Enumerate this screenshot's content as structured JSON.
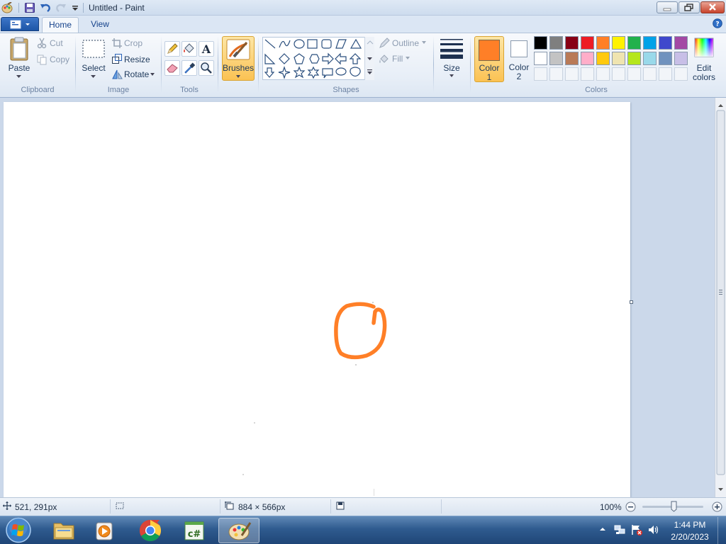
{
  "window": {
    "title": "Untitled - Paint"
  },
  "tabs": {
    "home": "Home",
    "view": "View"
  },
  "clipboard": {
    "group": "Clipboard",
    "paste": "Paste",
    "cut": "Cut",
    "copy": "Copy"
  },
  "image": {
    "group": "Image",
    "select": "Select",
    "crop": "Crop",
    "resize": "Resize",
    "rotate": "Rotate"
  },
  "tools": {
    "group": "Tools"
  },
  "brushes": {
    "label": "Brushes"
  },
  "shapes": {
    "group": "Shapes",
    "outline": "Outline",
    "fill": "Fill"
  },
  "size": {
    "label": "Size"
  },
  "colors": {
    "group": "Colors",
    "color1_line1": "Color",
    "color1_line2": "1",
    "color2_line1": "Color",
    "color2_line2": "2",
    "edit_line1": "Edit",
    "edit_line2": "colors",
    "color1_value": "#ff7f27",
    "color2_value": "#ffffff",
    "palette_row1": [
      "#000000",
      "#7f7f7f",
      "#880015",
      "#ed1c24",
      "#ff7f27",
      "#fff200",
      "#22b14c",
      "#00a2e8",
      "#3f48cc",
      "#a349a4"
    ],
    "palette_row2": [
      "#ffffff",
      "#c3c3c3",
      "#b97a57",
      "#ffaec9",
      "#ffc90e",
      "#efe4b0",
      "#b5e61d",
      "#99d9ea",
      "#7092be",
      "#c8bfe7"
    ]
  },
  "status": {
    "cursor_pos": "521, 291px",
    "canvas_size": "884 × 566px",
    "zoom": "100%"
  },
  "taskbar": {
    "time": "1:44 PM",
    "date": "2/20/2023"
  }
}
